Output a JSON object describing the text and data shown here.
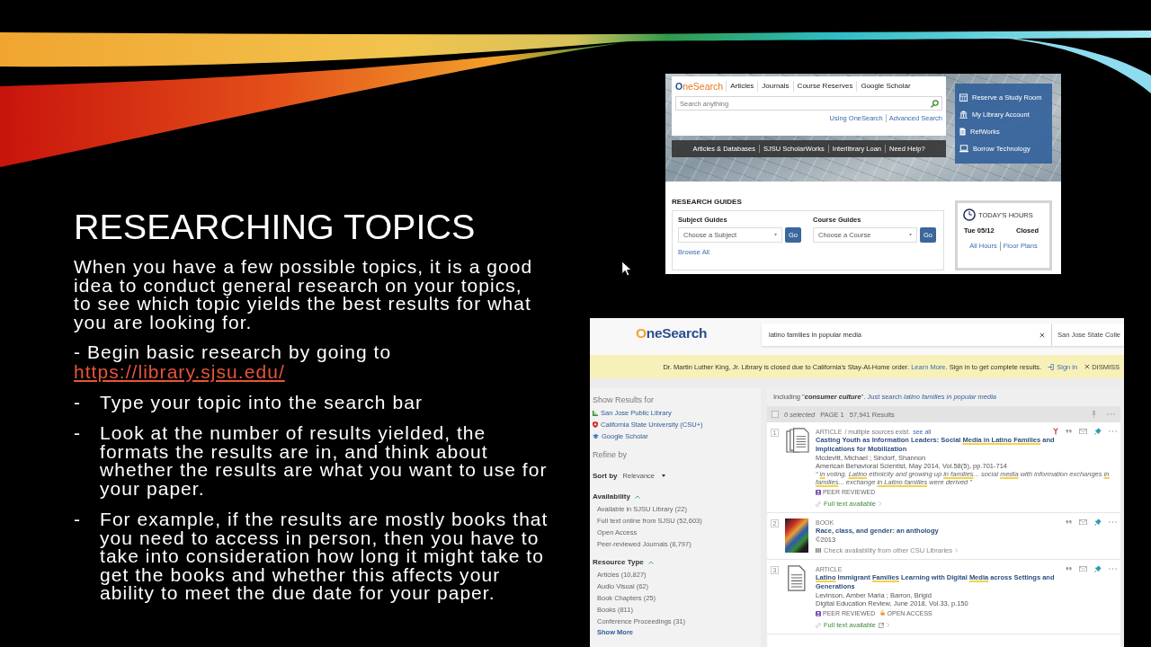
{
  "slide": {
    "title": "RESEARCHING TOPICS",
    "intro": "When you have a few possible topics, it is a good idea to conduct general research on your topics, to see which topic yields the best results for what you are looking for.",
    "lead": "- Begin basic research by going to",
    "link": "https://library.sjsu.edu/",
    "bullets": [
      {
        "marker": "-",
        "text": "Type your topic into the search bar"
      },
      {
        "marker": "-",
        "text": "Look at the number of results yielded, the formats the results are in, and think about whether the results are what you want to use for your paper."
      },
      {
        "marker": "-",
        "text": "For example, if the results are mostly books that you need to access in person, then you have to take into consideration how long it might take to get the books and whether this affects your ability to meet the due date for your paper."
      }
    ]
  },
  "library_home": {
    "logo": "OneSearch",
    "tabs": [
      "Articles",
      "Journals",
      "Course Reserves",
      "Google Scholar"
    ],
    "search": {
      "placeholder": "Search anything"
    },
    "search_links": [
      "Using OneSearch",
      "Advanced Search"
    ],
    "nav_bar": [
      "Articles & Databases",
      "SJSU ScholarWorks",
      "Interlibrary Loan",
      "Need Help?"
    ],
    "quick_links": [
      "Reserve a Study Room",
      "My Library Account",
      "RefWorks",
      "Borrow Technology"
    ],
    "research_guides": {
      "heading": "RESEARCH GUIDES",
      "guides": [
        {
          "label": "Subject Guides",
          "select": "Choose a Subject",
          "button": "Go"
        },
        {
          "label": "Course Guides",
          "select": "Choose a Course",
          "button": "Go"
        }
      ],
      "browse_all": "Browse All"
    },
    "hours": {
      "heading": "TODAY'S HOURS",
      "date": "Tue 05/12",
      "status": "Closed",
      "links": [
        "All Hours",
        "Floor Plans"
      ]
    }
  },
  "onesearch": {
    "logo": "OneSearch",
    "search": {
      "value": "latino families in popular media"
    },
    "scope": "San Jose State Colle",
    "banner": {
      "text": "Dr. Martin Luther King, Jr. Library is closed due to California's Stay-At-Home order.",
      "link": "Learn More",
      "text_after": ". Sign in to get complete results.",
      "sign_in": "Sign in",
      "dismiss": "DISMISS"
    },
    "sidebar": {
      "show_results": "Show Results for",
      "sources": [
        "San Jose Public Library",
        "California State University (CSU+)",
        "Google Scholar"
      ],
      "refine": "Refine by",
      "sort": {
        "label": "Sort by",
        "value": "Relevance"
      },
      "facets": [
        {
          "title": "Availability",
          "expanded": true,
          "options": [
            "Available in SJSU Library (22)",
            "Full text online from SJSU (52,603)",
            "Open Access",
            "Peer-reviewed Journals (8,797)"
          ]
        },
        {
          "title": "Resource Type",
          "expanded": true,
          "options": [
            "Articles (10,827)",
            "Audio Visual (62)",
            "Book Chapters (25)",
            "Books (811)",
            "Conference Proceedings (31)"
          ]
        }
      ],
      "show_more": "Show More"
    },
    "suggestion": {
      "text": "Including \"**consumer culture**\".",
      "link": "Just search *latino families in popular media*"
    },
    "toolbar": {
      "checked": false,
      "selected": "0 selected",
      "page": "PAGE 1",
      "count": "57,941 Results"
    },
    "results": [
      {
        "number": "1",
        "kind": "multisource",
        "type": "ARTICLE",
        "type_note": "/ multiple sources exist.",
        "see_all": "see all",
        "title": [
          {
            "text": "Casting Youth as Information Leaders: Social ",
            "highlight": false
          },
          {
            "text": "Media in Latino Families",
            "highlight": true
          },
          {
            "text": " and Implications for Mobilization",
            "highlight": false
          }
        ],
        "authors": "Mcdevitt, Michael ; Sindorf, Shannon",
        "source": "American Behavioral Scientist, May 2014, Vol.58(5), pp.701-714",
        "snippet": [
          {
            "text": "“ ",
            "highlight": false
          },
          {
            "text": "in",
            "highlight": true
          },
          {
            "text": " voting. ",
            "highlight": false
          },
          {
            "text": "Latino",
            "highlight": true
          },
          {
            "text": " ethnicity and growing up ",
            "highlight": false
          },
          {
            "text": "in families",
            "highlight": true
          },
          {
            "text": "... social ",
            "highlight": false
          },
          {
            "text": "media",
            "highlight": true
          },
          {
            "text": " with information exchanges ",
            "highlight": false
          },
          {
            "text": "in families",
            "highlight": true
          },
          {
            "text": "... exchange ",
            "highlight": false
          },
          {
            "text": "in Latino families",
            "highlight": true
          },
          {
            "text": " were derived ”",
            "highlight": false
          }
        ],
        "badges": [
          {
            "kind": "peer",
            "label": "PEER REVIEWED"
          }
        ],
        "availability": {
          "kind": "fulltext",
          "text": "Full text available",
          "external": false
        },
        "citation_icon": true
      },
      {
        "number": "2",
        "kind": "book",
        "type": "BOOK",
        "title": [
          {
            "text": "Race, class, and gender: an anthology",
            "highlight": false
          }
        ],
        "date": "©2013",
        "availability": {
          "kind": "check",
          "text": "Check availability from other CSU Libraries",
          "external": false
        },
        "citation_icon": false
      },
      {
        "number": "3",
        "kind": "article",
        "type": "ARTICLE",
        "title": [
          {
            "text": "Latino",
            "highlight": true
          },
          {
            "text": " Immigrant ",
            "highlight": false
          },
          {
            "text": "Families",
            "highlight": true
          },
          {
            "text": " Learning with Digital ",
            "highlight": false
          },
          {
            "text": "Media",
            "highlight": true
          },
          {
            "text": " across Settings and Generations",
            "highlight": false
          }
        ],
        "authors": "Levinson, Amber Maria ; Barron, Brigid",
        "source": "Digital Education Review, June 2018, Vol.33, p.150",
        "badges": [
          {
            "kind": "peer",
            "label": "PEER REVIEWED"
          },
          {
            "kind": "open",
            "label": "OPEN ACCESS"
          }
        ],
        "availability": {
          "kind": "fulltext",
          "text": "Full text available",
          "external": true
        },
        "citation_icon": false
      }
    ]
  }
}
